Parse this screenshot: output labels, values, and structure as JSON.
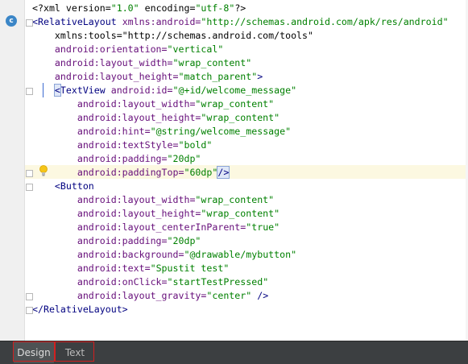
{
  "editor": {
    "lines": [
      [
        {
          "t": "<?xml version=",
          "c": "pi"
        },
        {
          "t": "\"1.0\"",
          "c": "val"
        },
        {
          "t": " encoding=",
          "c": "pi"
        },
        {
          "t": "\"utf-8\"",
          "c": "val"
        },
        {
          "t": "?>",
          "c": "pi"
        }
      ],
      [
        {
          "t": "<RelativeLayout ",
          "c": "tag"
        },
        {
          "t": "xmlns:android=",
          "c": "attr"
        },
        {
          "t": "\"http://schemas.android.com/apk/res/android\"",
          "c": "val"
        }
      ],
      [
        {
          "t": "    xmlns:tools=\"http://schemas.android.com/tools\"",
          "c": "pi"
        }
      ],
      [
        {
          "t": "    android:orientation=",
          "c": "attr"
        },
        {
          "t": "\"vertical\"",
          "c": "val"
        }
      ],
      [
        {
          "t": "    android:layout_width=",
          "c": "attr"
        },
        {
          "t": "\"wrap_content\"",
          "c": "val"
        }
      ],
      [
        {
          "t": "    android:layout_height=",
          "c": "attr"
        },
        {
          "t": "\"match_parent\"",
          "c": "val"
        },
        {
          "t": ">",
          "c": "tag"
        }
      ],
      [
        {
          "t": "    ",
          "c": "pi"
        },
        {
          "t": "<",
          "c": "tag box"
        },
        {
          "t": "TextView ",
          "c": "tag"
        },
        {
          "t": "android:id=",
          "c": "attr"
        },
        {
          "t": "\"@+id/welcome_message\"",
          "c": "val"
        }
      ],
      [
        {
          "t": "        android:layout_width=",
          "c": "attr"
        },
        {
          "t": "\"wrap_content\"",
          "c": "val"
        }
      ],
      [
        {
          "t": "        android:layout_height=",
          "c": "attr"
        },
        {
          "t": "\"wrap_content\"",
          "c": "val"
        }
      ],
      [
        {
          "t": "        android:hint=",
          "c": "attr"
        },
        {
          "t": "\"@string/welcome_message\"",
          "c": "val"
        }
      ],
      [
        {
          "t": "        android:textStyle=",
          "c": "attr"
        },
        {
          "t": "\"bold\"",
          "c": "val"
        }
      ],
      [
        {
          "t": "        android:padding=",
          "c": "attr"
        },
        {
          "t": "\"20dp\"",
          "c": "val"
        }
      ],
      [
        {
          "t": "        android:paddingTop=",
          "c": "attr"
        },
        {
          "t": "\"60dp\"",
          "c": "val"
        },
        {
          "t": "/>",
          "c": "tag box"
        }
      ],
      [
        {
          "t": "    <Button",
          "c": "tag"
        }
      ],
      [
        {
          "t": "        android:layout_width=",
          "c": "attr"
        },
        {
          "t": "\"wrap_content\"",
          "c": "val"
        }
      ],
      [
        {
          "t": "        android:layout_height=",
          "c": "attr"
        },
        {
          "t": "\"wrap_content\"",
          "c": "val"
        }
      ],
      [
        {
          "t": "        android:layout_centerInParent=",
          "c": "attr"
        },
        {
          "t": "\"true\"",
          "c": "val"
        }
      ],
      [
        {
          "t": "        android:padding=",
          "c": "attr"
        },
        {
          "t": "\"20dp\"",
          "c": "val"
        }
      ],
      [
        {
          "t": "        android:background=",
          "c": "attr"
        },
        {
          "t": "\"@drawable/mybutton\"",
          "c": "val"
        }
      ],
      [
        {
          "t": "        android:text=",
          "c": "attr"
        },
        {
          "t": "\"Spustit test\"",
          "c": "val"
        }
      ],
      [
        {
          "t": "        android:onClick=",
          "c": "attr"
        },
        {
          "t": "\"startTestPressed\"",
          "c": "val"
        }
      ],
      [
        {
          "t": "        android:layout_gravity=",
          "c": "attr"
        },
        {
          "t": "\"center\"",
          "c": "val"
        },
        {
          "t": " />",
          "c": "tag"
        }
      ],
      [
        {
          "t": "</RelativeLayout>",
          "c": "tag"
        }
      ]
    ],
    "highlighted_line": 12
  },
  "gutter": {
    "class_icon_glyph": "c"
  },
  "bottom_tabs": [
    {
      "label": "Design",
      "active": true
    },
    {
      "label": "Text",
      "active": false
    }
  ],
  "colors": {
    "tag": "#000080",
    "attribute": "#660e7a",
    "value": "#008000",
    "highlight": "#fcf8e1",
    "annotation_box": "#d21f1f"
  }
}
